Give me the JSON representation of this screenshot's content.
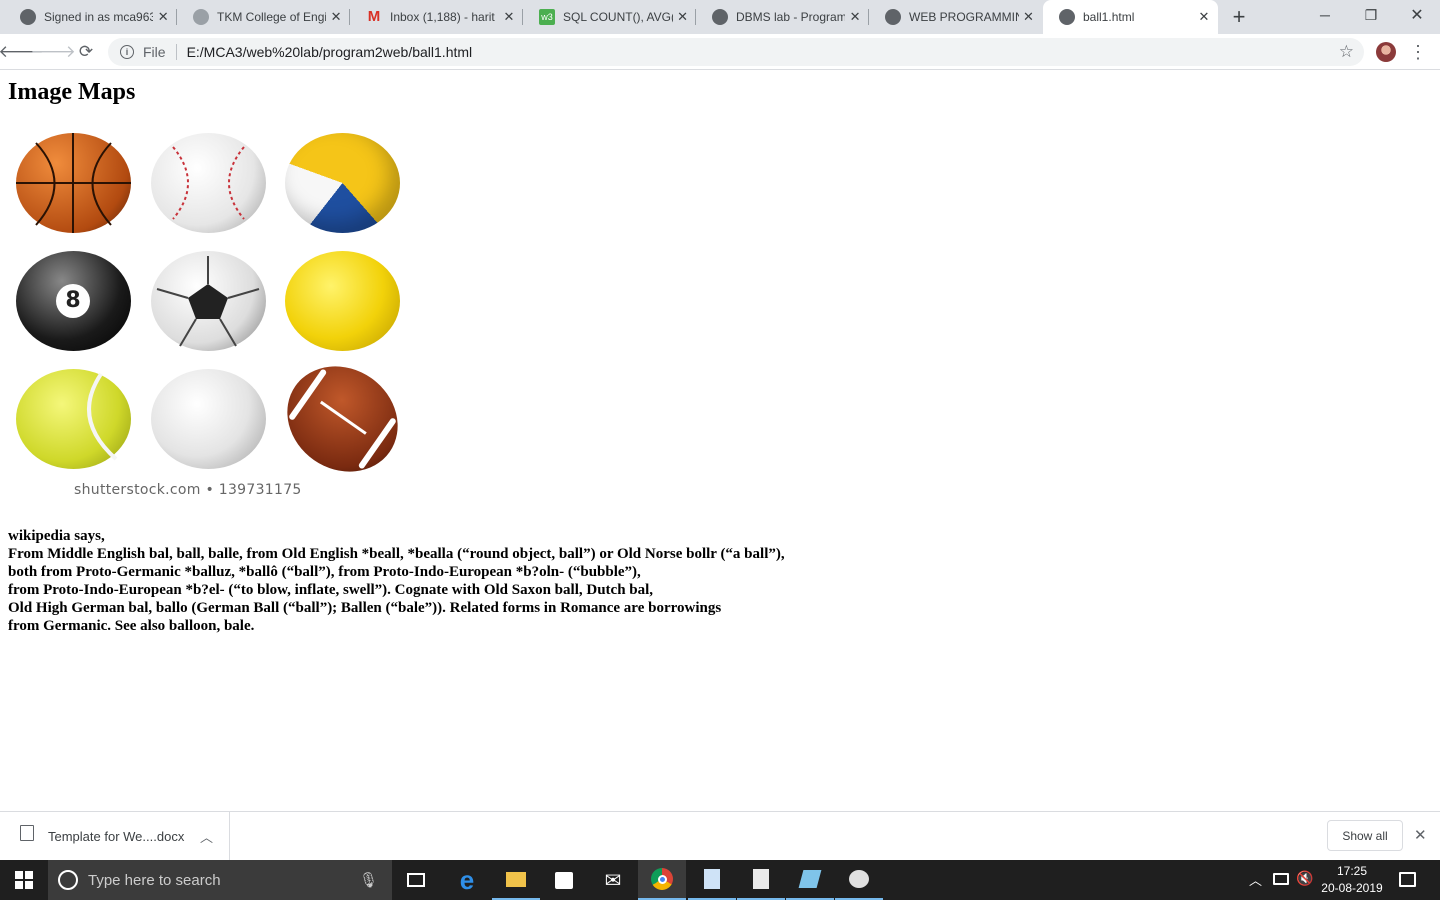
{
  "tabs": [
    {
      "title": "Signed in as mca963",
      "icon": "globe-icon"
    },
    {
      "title": "TKM College of Engi",
      "icon": "college-logo-icon"
    },
    {
      "title": "Inbox (1,188) - harit",
      "icon": "gmail-icon"
    },
    {
      "title": "SQL COUNT(), AVG()",
      "icon": "w3schools-icon"
    },
    {
      "title": "DBMS lab - Program",
      "icon": "globe-icon"
    },
    {
      "title": "WEB PROGRAMMIN",
      "icon": "globe-icon"
    },
    {
      "title": "ball1.html",
      "icon": "globe-icon"
    }
  ],
  "address": {
    "scheme_label": "File",
    "url": "E:/MCA3/web%20lab/program2web/ball1.html"
  },
  "page": {
    "heading": "Image Maps",
    "image_credit": "shutterstock.com • 139731175",
    "balls": [
      "basketball",
      "baseball",
      "volleyball",
      "eight-ball",
      "soccer-ball",
      "yellow-ball",
      "tennis-ball",
      "golf-ball",
      "football"
    ],
    "lines": [
      "wikipedia says,",
      "From Middle English bal, ball, balle, from Old English *beall, *bealla (“round object, ball”) or Old Norse bollr (“a ball”),",
      "both from Proto-Germanic *balluz, *ballô (“ball”), from Proto-Indo-European *b?oln- (“bubble”),",
      "from Proto-Indo-European *b?el- (“to blow, inflate, swell”). Cognate with Old Saxon ball, Dutch bal,",
      "Old High German bal, ballo (German Ball (“ball”); Ballen (“bale”)). Related forms in Romance are borrowings",
      "from Germanic. See also balloon, bale."
    ]
  },
  "downloads": {
    "file": "Template for We....docx",
    "show_all": "Show all"
  },
  "taskbar": {
    "search_placeholder": "Type here to search",
    "time": "17:25",
    "date": "20-08-2019"
  },
  "colors": {
    "tabbar": "#dee1e6",
    "taskbar": "#1f1f1f",
    "accent": "#0078d7"
  }
}
